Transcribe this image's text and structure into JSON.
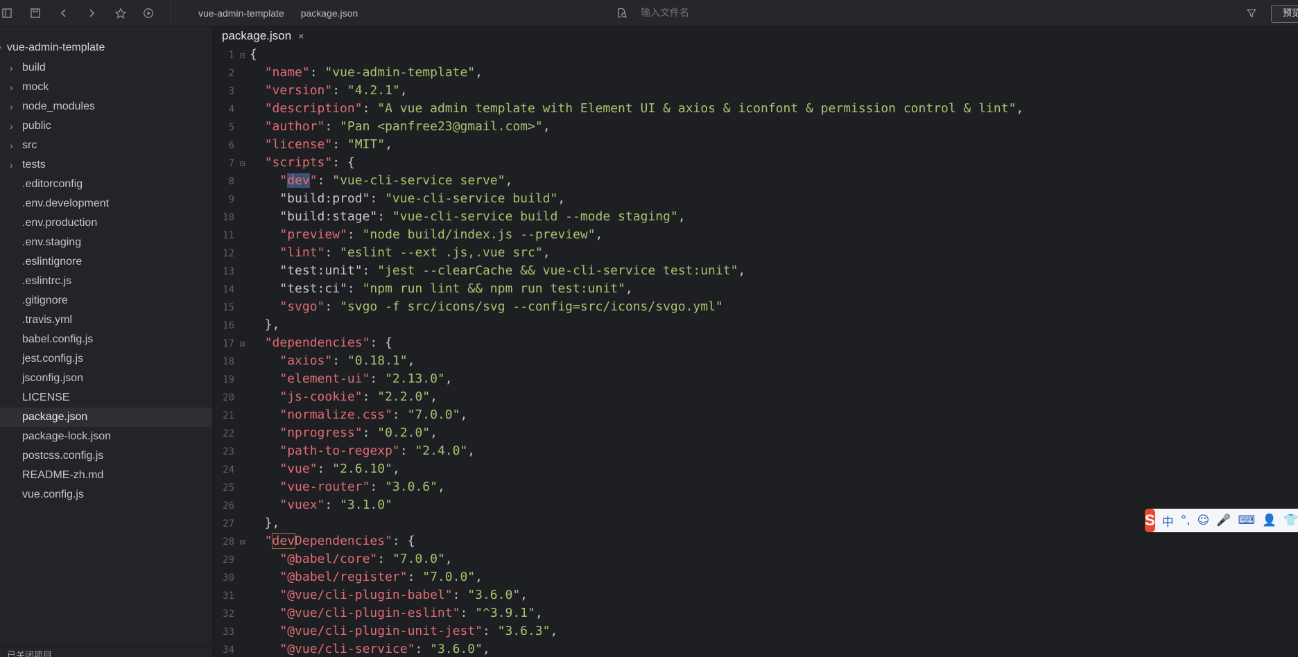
{
  "toolbar": {
    "breadcrumbs": [
      "vue-admin-template",
      "package.json"
    ],
    "search_placeholder": "输入文件名",
    "preview_label": "预览"
  },
  "sidebar": {
    "root": "vue-admin-template",
    "folders": [
      "build",
      "mock",
      "node_modules",
      "public",
      "src",
      "tests"
    ],
    "files": [
      ".editorconfig",
      ".env.development",
      ".env.production",
      ".env.staging",
      ".eslintignore",
      ".eslintrc.js",
      ".gitignore",
      ".travis.yml",
      "babel.config.js",
      "jest.config.js",
      "jsconfig.json",
      "LICENSE",
      "package.json",
      "package-lock.json",
      "postcss.config.js",
      "README-zh.md",
      "vue.config.js"
    ],
    "selected": "package.json",
    "footer": "已关闭项目"
  },
  "editor": {
    "tab_label": "package.json",
    "tab_close": "×"
  },
  "ime": {
    "logo": "S",
    "items": [
      "中",
      "°,",
      "☺",
      "🎤",
      "⌨",
      "👤",
      "👕"
    ]
  },
  "code_lines": [
    {
      "n": "1",
      "fold": true,
      "parts": [
        [
          "p",
          "{"
        ]
      ]
    },
    {
      "n": "2",
      "parts": [
        [
          "p",
          "  "
        ],
        [
          "k",
          "\"name\""
        ],
        [
          "p",
          ": "
        ],
        [
          "s",
          "\"vue-admin-template\""
        ],
        [
          "p",
          ","
        ]
      ]
    },
    {
      "n": "3",
      "parts": [
        [
          "p",
          "  "
        ],
        [
          "k",
          "\"version\""
        ],
        [
          "p",
          ": "
        ],
        [
          "s",
          "\"4.2.1\""
        ],
        [
          "p",
          ","
        ]
      ]
    },
    {
      "n": "4",
      "parts": [
        [
          "p",
          "  "
        ],
        [
          "k",
          "\"description\""
        ],
        [
          "p",
          ": "
        ],
        [
          "s",
          "\"A vue admin template with Element UI & axios & iconfont & permission control & lint\""
        ],
        [
          "p",
          ","
        ]
      ]
    },
    {
      "n": "5",
      "parts": [
        [
          "p",
          "  "
        ],
        [
          "k",
          "\"author\""
        ],
        [
          "p",
          ": "
        ],
        [
          "s",
          "\"Pan <panfree23@gmail.com>\""
        ],
        [
          "p",
          ","
        ]
      ]
    },
    {
      "n": "6",
      "parts": [
        [
          "p",
          "  "
        ],
        [
          "k",
          "\"license\""
        ],
        [
          "p",
          ": "
        ],
        [
          "s",
          "\"MIT\""
        ],
        [
          "p",
          ","
        ]
      ]
    },
    {
      "n": "7",
      "fold": true,
      "parts": [
        [
          "p",
          "  "
        ],
        [
          "k",
          "\"scripts\""
        ],
        [
          "p",
          ": {"
        ]
      ]
    },
    {
      "n": "8",
      "parts": [
        [
          "p",
          "    "
        ],
        [
          "k",
          "\""
        ],
        [
          "hl",
          "dev"
        ],
        [
          "k",
          "\""
        ],
        [
          "p",
          ": "
        ],
        [
          "s",
          "\"vue-cli-service serve\""
        ],
        [
          "p",
          ","
        ]
      ]
    },
    {
      "n": "9",
      "parts": [
        [
          "p",
          "    \"build:prod\": "
        ],
        [
          "s",
          "\"vue-cli-service build\""
        ],
        [
          "p",
          ","
        ]
      ]
    },
    {
      "n": "10",
      "parts": [
        [
          "p",
          "    \"build:stage\": "
        ],
        [
          "s",
          "\"vue-cli-service build --mode staging\""
        ],
        [
          "p",
          ","
        ]
      ]
    },
    {
      "n": "11",
      "parts": [
        [
          "p",
          "    "
        ],
        [
          "k",
          "\"preview\""
        ],
        [
          "p",
          ": "
        ],
        [
          "s",
          "\"node build/index.js --preview\""
        ],
        [
          "p",
          ","
        ]
      ]
    },
    {
      "n": "12",
      "parts": [
        [
          "p",
          "    "
        ],
        [
          "k",
          "\"lint\""
        ],
        [
          "p",
          ": "
        ],
        [
          "s",
          "\"eslint --ext .js,.vue src\""
        ],
        [
          "p",
          ","
        ]
      ]
    },
    {
      "n": "13",
      "parts": [
        [
          "p",
          "    \"test:unit\": "
        ],
        [
          "s",
          "\"jest --clearCache && vue-cli-service test:unit\""
        ],
        [
          "p",
          ","
        ]
      ]
    },
    {
      "n": "14",
      "parts": [
        [
          "p",
          "    \"test:ci\": "
        ],
        [
          "s",
          "\"npm run lint && npm run test:unit\""
        ],
        [
          "p",
          ","
        ]
      ]
    },
    {
      "n": "15",
      "parts": [
        [
          "p",
          "    "
        ],
        [
          "k",
          "\"svgo\""
        ],
        [
          "p",
          ": "
        ],
        [
          "s",
          "\"svgo -f src/icons/svg --config=src/icons/svgo.yml\""
        ]
      ]
    },
    {
      "n": "16",
      "parts": [
        [
          "p",
          "  },"
        ]
      ]
    },
    {
      "n": "17",
      "fold": true,
      "parts": [
        [
          "p",
          "  "
        ],
        [
          "k",
          "\"dependencies\""
        ],
        [
          "p",
          ": {"
        ]
      ]
    },
    {
      "n": "18",
      "parts": [
        [
          "p",
          "    "
        ],
        [
          "k",
          "\"axios\""
        ],
        [
          "p",
          ": "
        ],
        [
          "s",
          "\"0.18.1\""
        ],
        [
          "p",
          ","
        ]
      ]
    },
    {
      "n": "19",
      "parts": [
        [
          "p",
          "    "
        ],
        [
          "k",
          "\"element-ui\""
        ],
        [
          "p",
          ": "
        ],
        [
          "s",
          "\"2.13.0\""
        ],
        [
          "p",
          ","
        ]
      ]
    },
    {
      "n": "20",
      "parts": [
        [
          "p",
          "    "
        ],
        [
          "k",
          "\"js-cookie\""
        ],
        [
          "p",
          ": "
        ],
        [
          "s",
          "\"2.2.0\""
        ],
        [
          "p",
          ","
        ]
      ]
    },
    {
      "n": "21",
      "parts": [
        [
          "p",
          "    "
        ],
        [
          "k",
          "\"normalize.css\""
        ],
        [
          "p",
          ": "
        ],
        [
          "s",
          "\"7.0.0\""
        ],
        [
          "p",
          ","
        ]
      ]
    },
    {
      "n": "22",
      "parts": [
        [
          "p",
          "    "
        ],
        [
          "k",
          "\"nprogress\""
        ],
        [
          "p",
          ": "
        ],
        [
          "s",
          "\"0.2.0\""
        ],
        [
          "p",
          ","
        ]
      ]
    },
    {
      "n": "23",
      "parts": [
        [
          "p",
          "    "
        ],
        [
          "k",
          "\"path-to-regexp\""
        ],
        [
          "p",
          ": "
        ],
        [
          "s",
          "\"2.4.0\""
        ],
        [
          "p",
          ","
        ]
      ]
    },
    {
      "n": "24",
      "parts": [
        [
          "p",
          "    "
        ],
        [
          "k",
          "\"vue\""
        ],
        [
          "p",
          ": "
        ],
        [
          "s",
          "\"2.6.10\""
        ],
        [
          "p",
          ","
        ]
      ]
    },
    {
      "n": "25",
      "parts": [
        [
          "p",
          "    "
        ],
        [
          "k",
          "\"vue-router\""
        ],
        [
          "p",
          ": "
        ],
        [
          "s",
          "\"3.0.6\""
        ],
        [
          "p",
          ","
        ]
      ]
    },
    {
      "n": "26",
      "parts": [
        [
          "p",
          "    "
        ],
        [
          "k",
          "\"vuex\""
        ],
        [
          "p",
          ": "
        ],
        [
          "s",
          "\"3.1.0\""
        ]
      ]
    },
    {
      "n": "27",
      "parts": [
        [
          "p",
          "  },"
        ]
      ]
    },
    {
      "n": "28",
      "fold": true,
      "parts": [
        [
          "p",
          "  "
        ],
        [
          "k",
          "\""
        ],
        [
          "box",
          "dev"
        ],
        [
          "k",
          "Dependencies\""
        ],
        [
          "p",
          ": {"
        ]
      ]
    },
    {
      "n": "29",
      "parts": [
        [
          "p",
          "    "
        ],
        [
          "k",
          "\"@babel/core\""
        ],
        [
          "p",
          ": "
        ],
        [
          "s",
          "\"7.0.0\""
        ],
        [
          "p",
          ","
        ]
      ]
    },
    {
      "n": "30",
      "parts": [
        [
          "p",
          "    "
        ],
        [
          "k",
          "\"@babel/register\""
        ],
        [
          "p",
          ": "
        ],
        [
          "s",
          "\"7.0.0\""
        ],
        [
          "p",
          ","
        ]
      ]
    },
    {
      "n": "31",
      "parts": [
        [
          "p",
          "    "
        ],
        [
          "k",
          "\"@vue/cli-plugin-babel\""
        ],
        [
          "p",
          ": "
        ],
        [
          "s",
          "\"3.6.0\""
        ],
        [
          "p",
          ","
        ]
      ]
    },
    {
      "n": "32",
      "parts": [
        [
          "p",
          "    "
        ],
        [
          "k",
          "\"@vue/cli-plugin-eslint\""
        ],
        [
          "p",
          ": "
        ],
        [
          "s",
          "\"^3.9.1\""
        ],
        [
          "p",
          ","
        ]
      ]
    },
    {
      "n": "33",
      "parts": [
        [
          "p",
          "    "
        ],
        [
          "k",
          "\"@vue/cli-plugin-unit-jest\""
        ],
        [
          "p",
          ": "
        ],
        [
          "s",
          "\"3.6.3\""
        ],
        [
          "p",
          ","
        ]
      ]
    },
    {
      "n": "34",
      "parts": [
        [
          "p",
          "    "
        ],
        [
          "k",
          "\"@vue/cli-service\""
        ],
        [
          "p",
          ": "
        ],
        [
          "s",
          "\"3.6.0\""
        ],
        [
          "p",
          ","
        ]
      ]
    }
  ]
}
